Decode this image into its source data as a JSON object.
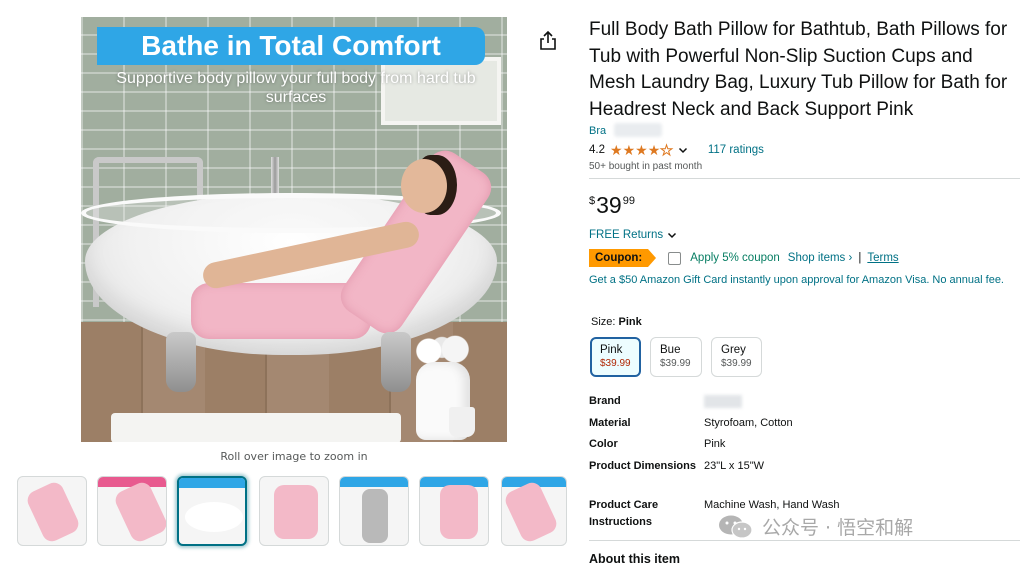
{
  "image": {
    "banner_title": "Bathe in Total Comfort",
    "banner_subtitle": "Supportive body pillow your full body from hard tub surfaces",
    "zoom_hint": "Roll over image to zoom in"
  },
  "thumbnails": {
    "count": 7,
    "selected_index": 2
  },
  "product": {
    "title": "Full Body Bath Pillow for Bathtub, Bath Pillows for Tub with Powerful Non-Slip Suction Cups and Mesh Laundry Bag, Luxury Tub Pillow for Bath for Headrest Neck and Back Support Pink",
    "brand_prefix": "Bra",
    "rating_value": "4.2",
    "stars_filled": 4,
    "ratings_count_text": "117 ratings",
    "bought_text": "50+ bought in past month"
  },
  "price": {
    "currency": "$",
    "whole": "39",
    "fraction": "99"
  },
  "returns": {
    "label": "FREE Returns"
  },
  "coupon": {
    "badge": "Coupon:",
    "text": "Apply 5% coupon",
    "shop_items": "Shop items ›",
    "separator": "|",
    "terms": "Terms"
  },
  "gift_card_text": "Get a $50 Amazon Gift Card instantly upon approval for Amazon Visa. No annual fee.",
  "size": {
    "label": "Size:",
    "selected": "Pink",
    "options": [
      {
        "name": "Pink",
        "price": "$39.99"
      },
      {
        "name": "Bue",
        "price": "$39.99"
      },
      {
        "name": "Grey",
        "price": "$39.99"
      }
    ]
  },
  "specs": [
    {
      "key": "Brand",
      "value": ""
    },
    {
      "key": "Material",
      "value": "Styrofoam, Cotton"
    },
    {
      "key": "Color",
      "value": "Pink"
    },
    {
      "key": "Product Dimensions",
      "value": "23\"L x 15\"W"
    },
    {
      "key": "Product Care Instructions",
      "value": "Machine Wash, Hand Wash"
    }
  ],
  "about_heading": "About this item",
  "watermark_text": "公众号 · 悟空和解",
  "colors": {
    "link": "#007185",
    "star": "#de7921",
    "coupon_badge": "#ff9900",
    "coupon_text": "#067d62",
    "sale_price": "#b12704",
    "banner": "#2fa6e6"
  },
  "icons": {
    "share": "share-icon",
    "chevron": "chevron-down-icon",
    "watermark": "wechat-icon"
  }
}
